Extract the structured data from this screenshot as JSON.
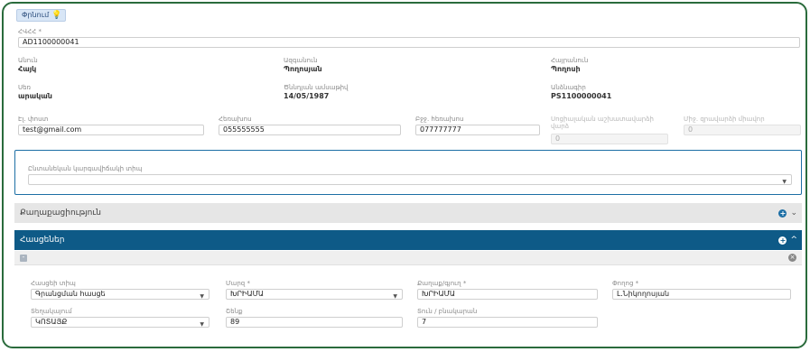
{
  "toolbar": {
    "search_label": "Փրնում"
  },
  "customer": {
    "hvhh_label": "ՀՎՀՀ *",
    "hvhh_value": "AD1100000041",
    "first_name_label": "Անուն",
    "first_name": "Հայկ",
    "last_name_label": "Ազգանուն",
    "last_name": "Պողոսյան",
    "patronymic_label": "Հայրանուն",
    "patronymic": "Պողոսի",
    "gender_label": "Սեռ",
    "gender": "արական",
    "birth_label": "Ծննդյան ամսաթիվ",
    "birth_date": "14/05/1987",
    "passport_label": "Անձնագիր",
    "passport": "PS1100000041",
    "email_label": "Էլ. փոստ",
    "email": "test@gmail.com",
    "phone_label": "Հեռախոս",
    "phone": "055555555",
    "mobile_label": "Բջջ. հեռախոս",
    "mobile": "077777777",
    "social_label": "Սոցիալական աշխատավարձի վարձ",
    "social_value": "0",
    "avg_label": "Միջ. զրավարձի միավոր",
    "avg_value": "0"
  },
  "legal": {
    "label": "Ընտանեկան կարգավիճակի տիպ",
    "value": ""
  },
  "sections": {
    "citizenship": "Քաղաքացիություն",
    "addresses": "Հասցեներ"
  },
  "address": {
    "type_label": "Հասցեի տիպ",
    "type_value": "Գրանցման հասցե",
    "country_label": "Մարզ *",
    "country_value": "ԽՐԻԱՄԱ",
    "city_label": "Քաղաք/գյուղ *",
    "city_value": "ԽՐԻԱՄԱ",
    "street_label": "Փողոց *",
    "street_value": "Լ.Նիկողոսյան",
    "district_label": "Տեղակայում",
    "district_value": "ԿՈՏԱՅՔ",
    "building_label": "Շենք",
    "building_value": "89",
    "apartment_label": "Տուն / բնակարան",
    "apartment_value": "7"
  }
}
